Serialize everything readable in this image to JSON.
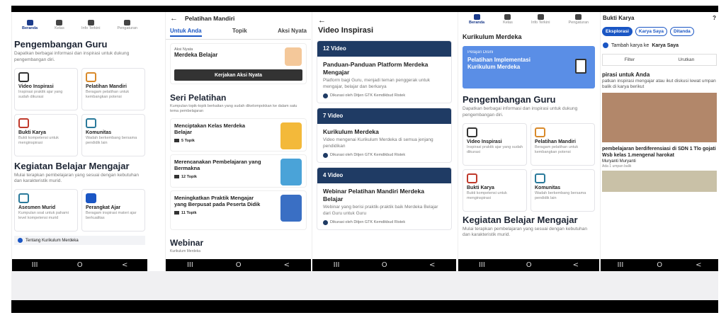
{
  "screen1": {
    "tabs": [
      "Beranda",
      "Kelas",
      "Info Terkini",
      "Pengaturan"
    ],
    "section_title": "Pengembangan Guru",
    "section_desc": "Dapatkan berbagai informasi dan inspirasi untuk dukung pengembangan diri.",
    "cards": [
      {
        "title": "Video Inspirasi",
        "desc": "Inspirasi praktik ajar yang sudah dikurasi"
      },
      {
        "title": "Pelatihan Mandiri",
        "desc": "Beragam pelatihan untuk kembangkan potensi"
      },
      {
        "title": "Bukti Karya",
        "desc": "Bukti kompetensi untuk menginspirasi"
      },
      {
        "title": "Komunitas",
        "desc": "Wadah berkembang bersama pendidik lain"
      }
    ],
    "kbm_title": "Kegiatan Belajar Mengajar",
    "kbm_desc": "Mulai terapkan pembelajaran yang sesuai dengan kebutuhan dan karakteristik murid.",
    "kbm_cards": [
      {
        "title": "Asesmen Murid",
        "desc": "Kumpulan soal untuk pahami level kompetensi murid"
      },
      {
        "title": "Perangkat Ajar",
        "desc": "Beragam inspirasi materi ajar berkualitas"
      }
    ],
    "info_link": "Tentang Kurikulum Merdeka"
  },
  "screen2": {
    "title": "Pelatihan Mandiri",
    "tabs": [
      "Untuk Anda",
      "Topik",
      "Aksi Nyata"
    ],
    "aksi_small": "Aksi Nyata",
    "aksi_title": "Merdeka Belajar",
    "aksi_button": "Kerjakan Aksi Nyata",
    "seri_title": "Seri Pelatihan",
    "seri_desc": "Kumpulan topik-topik berkaitan yang sudah dikelompokkan ke dalam satu tema pembelajaran",
    "items": [
      {
        "title": "Menciptakan Kelas Merdeka Belajar",
        "topics": "5 Topik"
      },
      {
        "title": "Merencanakan Pembelajaran yang Bermakna",
        "topics": "12 Topik"
      },
      {
        "title": "Meningkatkan Praktik Mengajar yang Berpusat pada Peserta Didik",
        "topics": "11 Topik"
      }
    ],
    "webinar_title": "Webinar",
    "webinar_small": "Kurikulum Merdeka"
  },
  "screen3": {
    "title": "Video Inspirasi",
    "videos": [
      {
        "count": "12 Video",
        "title": "Panduan-Panduan Platform Merdeka Mengajar",
        "desc": "Platform bagi Guru, menjadi teman penggerak untuk mengajar, belajar dan berkarya",
        "curator": "Dikurasi oleh Ditjen GTK Kemdikbud Ristek"
      },
      {
        "count": "7 Video",
        "title": "Kurikulum Merdeka",
        "desc": "Video mengenai Kurikulum Merdeka di semua jenjang pendidikan",
        "curator": "Dikurasi oleh Ditjen GTK Kemdikbud Ristek"
      },
      {
        "count": "4 Video",
        "title": "Webinar Pelatihan Mandiri Merdeka Belajar",
        "desc": "Webinar yang berisi praktik-praktik baik Merdeka Belajar dari Guru untuk Guru",
        "curator": "Dikurasi oleh Ditjen GTK Kemdikbud Ristek"
      }
    ]
  },
  "screen4": {
    "tabs": [
      "Beranda",
      "Kelas",
      "Info Terkini",
      "Pengaturan"
    ],
    "section_top": "Kurikulum Merdeka",
    "banner_small": "Pelajari Disini",
    "banner_title": "Pelatihan Implementasi Kurikulum Merdeka",
    "section_title": "Pengembangan Guru",
    "section_desc": "Dapatkan berbagai informasi dan inspirasi untuk dukung pengembangan diri.",
    "cards": [
      {
        "title": "Video Inspirasi",
        "desc": "Inspirasi praktik ajar yang sudah dikurasi"
      },
      {
        "title": "Pelatihan Mandiri",
        "desc": "Beragam pelatihan untuk kembangkan potensi"
      },
      {
        "title": "Bukti Karya",
        "desc": "Bukti kompetensi untuk menginspirasi"
      },
      {
        "title": "Komunitas",
        "desc": "Wadah berkembang bersama pendidik lain"
      }
    ],
    "kbm_title": "Kegiatan Belajar Mengajar",
    "kbm_desc": "Mulai terapkan pembelajaran yang sesuai dengan kebutuhan dan karakteristik murid."
  },
  "screen5": {
    "title": "Bukti Karya",
    "pills": [
      "Eksplorasi",
      "Karya Saya",
      "Ditanda"
    ],
    "add_text": "Tambah karya ke",
    "add_bold": "Karya Saya",
    "filter": "Filter",
    "sort": "Urutkan",
    "insp_title": "pirasi untuk Anda",
    "insp_desc": "patkan inspirasi mengajar atau ikut diskusi lewat umpan balik di karya berikut",
    "post_title": "pembelajaran berdiferensiasi di SDN 1 Tlo gojati Wsb kelas 1.mengenal harokat",
    "author": "Muryanti Muryanti",
    "feedback": "Ada 1 umpan balik"
  },
  "navbar": [
    "III",
    "O",
    "<"
  ]
}
